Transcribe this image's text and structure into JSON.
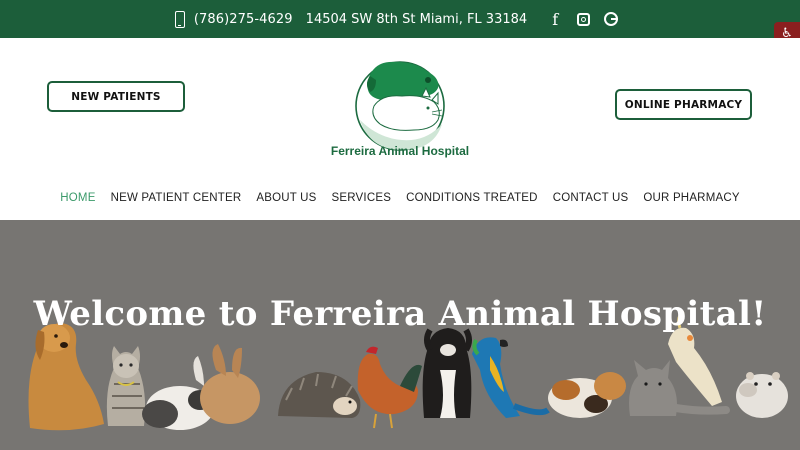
{
  "topbar": {
    "phone": "(786)275-4629",
    "address": "14504 SW 8th St Miami, FL 33184",
    "icons": [
      "phone-icon",
      "facebook-icon",
      "instagram-icon",
      "google-icon"
    ]
  },
  "accessibility": {
    "icon": "wheelchair-icon",
    "glyph": "♿"
  },
  "header": {
    "new_patients_label": "NEW PATIENTS",
    "online_pharmacy_label": "ONLINE PHARMACY",
    "logo_name": "Ferreira Animal Hospital"
  },
  "nav": {
    "items": [
      "HOME",
      "NEW PATIENT CENTER",
      "ABOUT US",
      "SERVICES",
      "CONDITIONS TREATED",
      "CONTACT US",
      "OUR PHARMACY"
    ],
    "active": "HOME"
  },
  "hero": {
    "title": "Welcome to Ferreira Animal Hospital!"
  },
  "colors": {
    "brand_green": "#1c5e3a",
    "nav_active": "#3b9a6a",
    "hero_bg": "#777572",
    "access_red": "#8b1f1f"
  }
}
